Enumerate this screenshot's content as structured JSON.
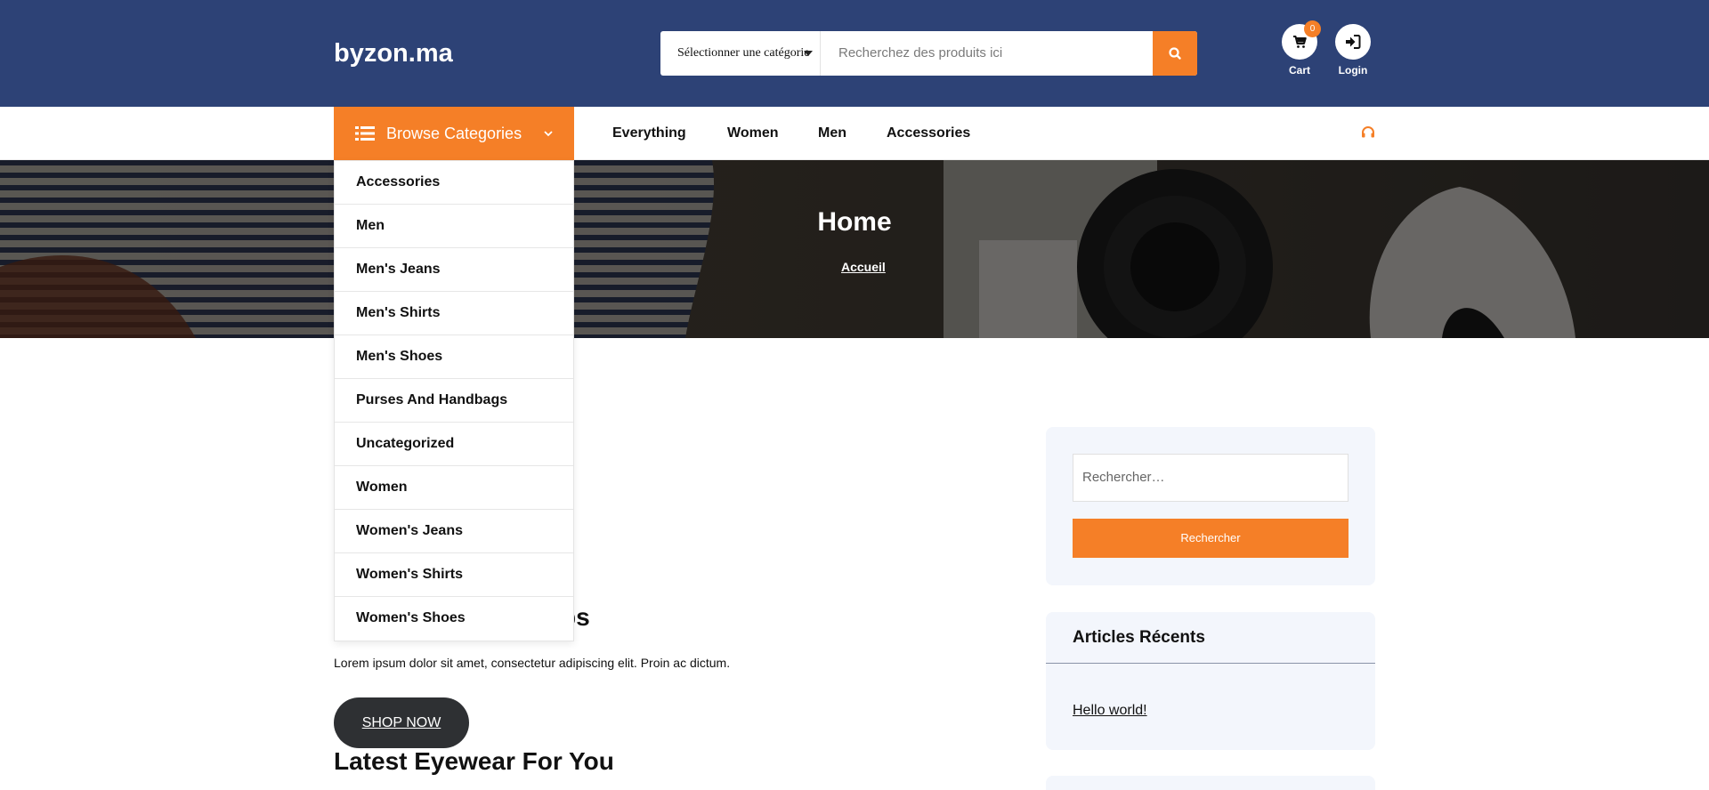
{
  "header": {
    "logo": "byzon.ma",
    "category_select": "Sélectionner une catégorie",
    "search_placeholder": "Recherchez des produits ici",
    "cart_count": "0",
    "cart_label": "Cart",
    "login_label": "Login"
  },
  "nav": {
    "browse_label": "Browse Categories",
    "links": [
      "Everything",
      "Women",
      "Men",
      "Accessories"
    ]
  },
  "categories": [
    "Accessories",
    "Men",
    "Men's Jeans",
    "Men's Shirts",
    "Men's Shoes",
    "Purses And Handbags",
    "Uncategorized",
    "Women",
    "Women's Jeans",
    "Women's Shirts",
    "Women's Shoes"
  ],
  "banner": {
    "title": "Home",
    "breadcrumb": "Accueil"
  },
  "main": {
    "hero_title_visible_tail": "ps",
    "hero_text": "Lorem ipsum dolor sit amet, consectetur adipiscing elit. Proin ac dictum.",
    "shop_button": "SHOP NOW",
    "second_title": "Latest Eyewear For You"
  },
  "sidebar": {
    "search_placeholder": "Rechercher…",
    "search_button": "Rechercher",
    "recent_heading": "Articles Récents",
    "recent_posts": [
      "Hello world!"
    ]
  },
  "colors": {
    "header_bg": "#2d4276",
    "accent": "#f57f27",
    "sidebar_bg": "#f3f6fc",
    "dark_button": "#2e3033"
  }
}
